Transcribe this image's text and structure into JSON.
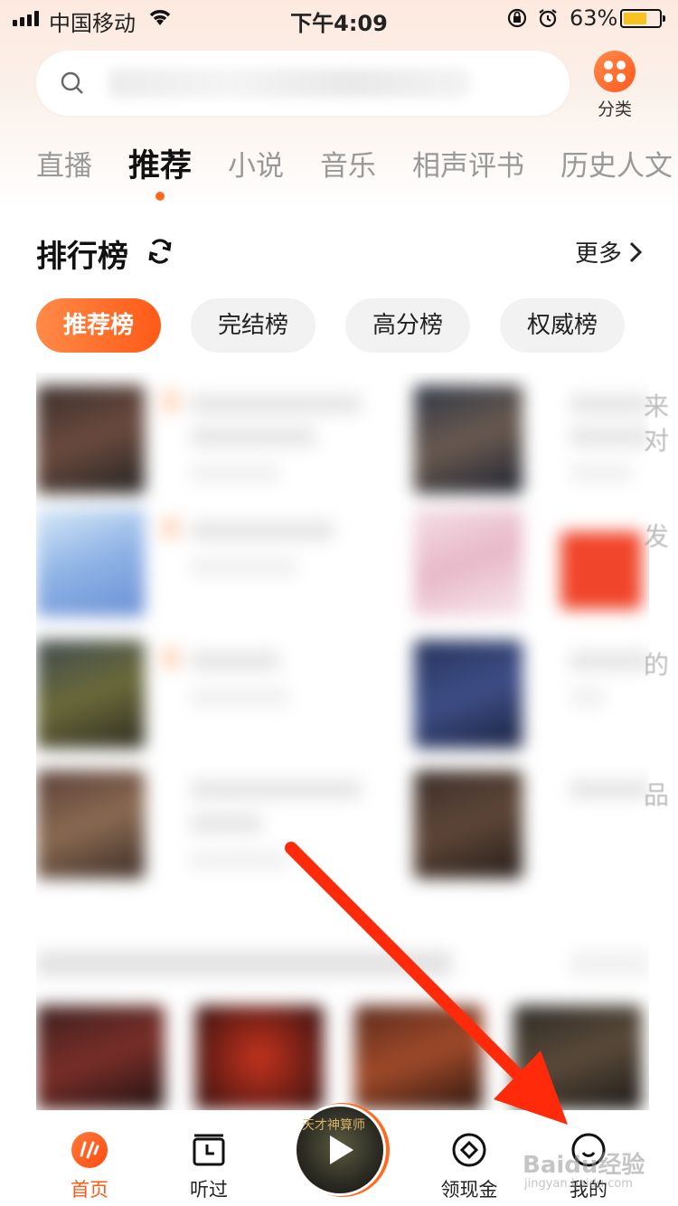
{
  "status_bar": {
    "carrier": "中国移动",
    "time": "下午4:09",
    "battery_percent": "63%",
    "battery_level": 0.63,
    "icons": [
      "signal-icon",
      "wifi-icon",
      "rotation-lock-icon",
      "alarm-icon",
      "battery-icon"
    ]
  },
  "search": {
    "placeholder": ""
  },
  "category": {
    "label": "分类"
  },
  "tabs": [
    {
      "label": "直播"
    },
    {
      "label": "推荐",
      "active": true
    },
    {
      "label": "小说"
    },
    {
      "label": "音乐"
    },
    {
      "label": "相声评书"
    },
    {
      "label": "历史人文"
    }
  ],
  "ranking": {
    "title": "排行榜",
    "more": "更多",
    "chips": [
      {
        "label": "推荐榜",
        "active": true
      },
      {
        "label": "完结榜"
      },
      {
        "label": "高分榜"
      },
      {
        "label": "权威榜"
      }
    ],
    "side_chars": [
      "来",
      "对",
      "发",
      "的",
      "品"
    ]
  },
  "player": {
    "cover_text": "天才神算师"
  },
  "bottom_nav": [
    {
      "label": "首页",
      "icon": "home-icon",
      "active": true
    },
    {
      "label": "听过",
      "icon": "history-calendar-icon"
    },
    {
      "label": "领现金",
      "icon": "cash-diamond-icon"
    },
    {
      "label": "我的",
      "icon": "profile-icon"
    }
  ],
  "watermark": {
    "text": "Baidu经验",
    "sub": "jingyan.baidu.com"
  },
  "colors": {
    "accent": "#ff5a16",
    "arrow": "#ff2a0a"
  }
}
